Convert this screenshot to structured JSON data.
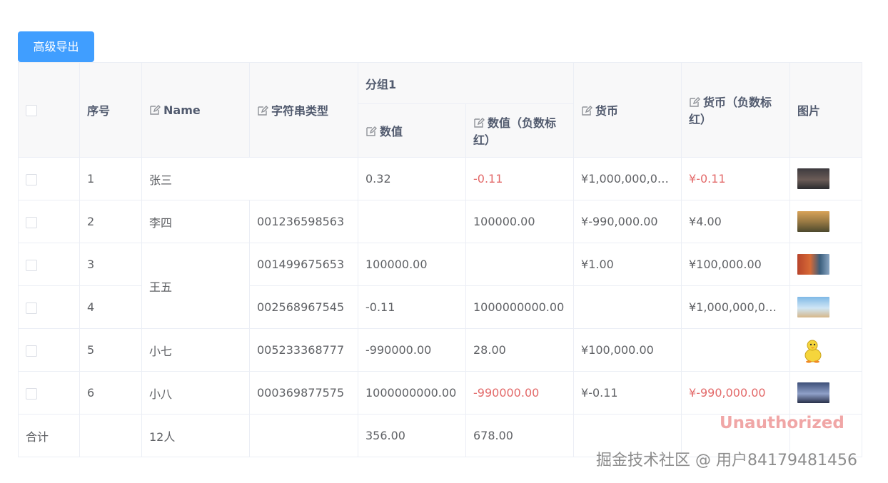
{
  "toolbar": {
    "export_label": "高级导出"
  },
  "table": {
    "headers": {
      "index": "序号",
      "name": "Name",
      "string_type": "字符串类型",
      "group1": "分组1",
      "number": "数值",
      "number_neg_red": "数值（负数标红）",
      "currency": "货币",
      "currency_neg_red": "货币（负数标红）",
      "image": "图片"
    },
    "rows": [
      {
        "index": "1",
        "name": "张三",
        "string_type": "",
        "number": "0.32",
        "number_neg_red": "-0.11",
        "currency": "¥1,000,000,000...",
        "currency_neg_red": "¥-0.11"
      },
      {
        "index": "2",
        "name": "李四",
        "string_type": "001236598563",
        "number": "",
        "number_neg_red": "100000.00",
        "currency": "¥-990,000.00",
        "currency_neg_red": "¥4.00"
      },
      {
        "index": "3",
        "name": "王五",
        "string_type": "001499675653",
        "number": "100000.00",
        "number_neg_red": "",
        "currency": "¥1.00",
        "currency_neg_red": "¥100,000.00"
      },
      {
        "index": "4",
        "name": "王五",
        "string_type": "002568967545",
        "number": "-0.11",
        "number_neg_red": "1000000000.00",
        "currency": "",
        "currency_neg_red": "¥1,000,000,000..."
      },
      {
        "index": "5",
        "name": "小七",
        "string_type": "005233368777",
        "number": "-990000.00",
        "number_neg_red": "28.00",
        "currency": "¥100,000.00",
        "currency_neg_red": ""
      },
      {
        "index": "6",
        "name": "小八",
        "string_type": "000369877575",
        "number": "1000000000.00",
        "number_neg_red": "-990000.00",
        "currency": "¥-0.11",
        "currency_neg_red": "¥-990,000.00"
      }
    ],
    "footer": {
      "label": "合计",
      "name": "12人",
      "number": "356.00",
      "number_neg_red": "678.00"
    }
  },
  "overlay": {
    "unauthorized": "Unauthorized",
    "site_watermark": "掘金技术社区 @ 用户84179481456"
  },
  "colors": {
    "primary": "#409eff",
    "negative": "#e36a6a",
    "header_bg": "#f8f8f9",
    "border": "#ebeef5"
  },
  "icons": {
    "edit": "edit-icon"
  }
}
